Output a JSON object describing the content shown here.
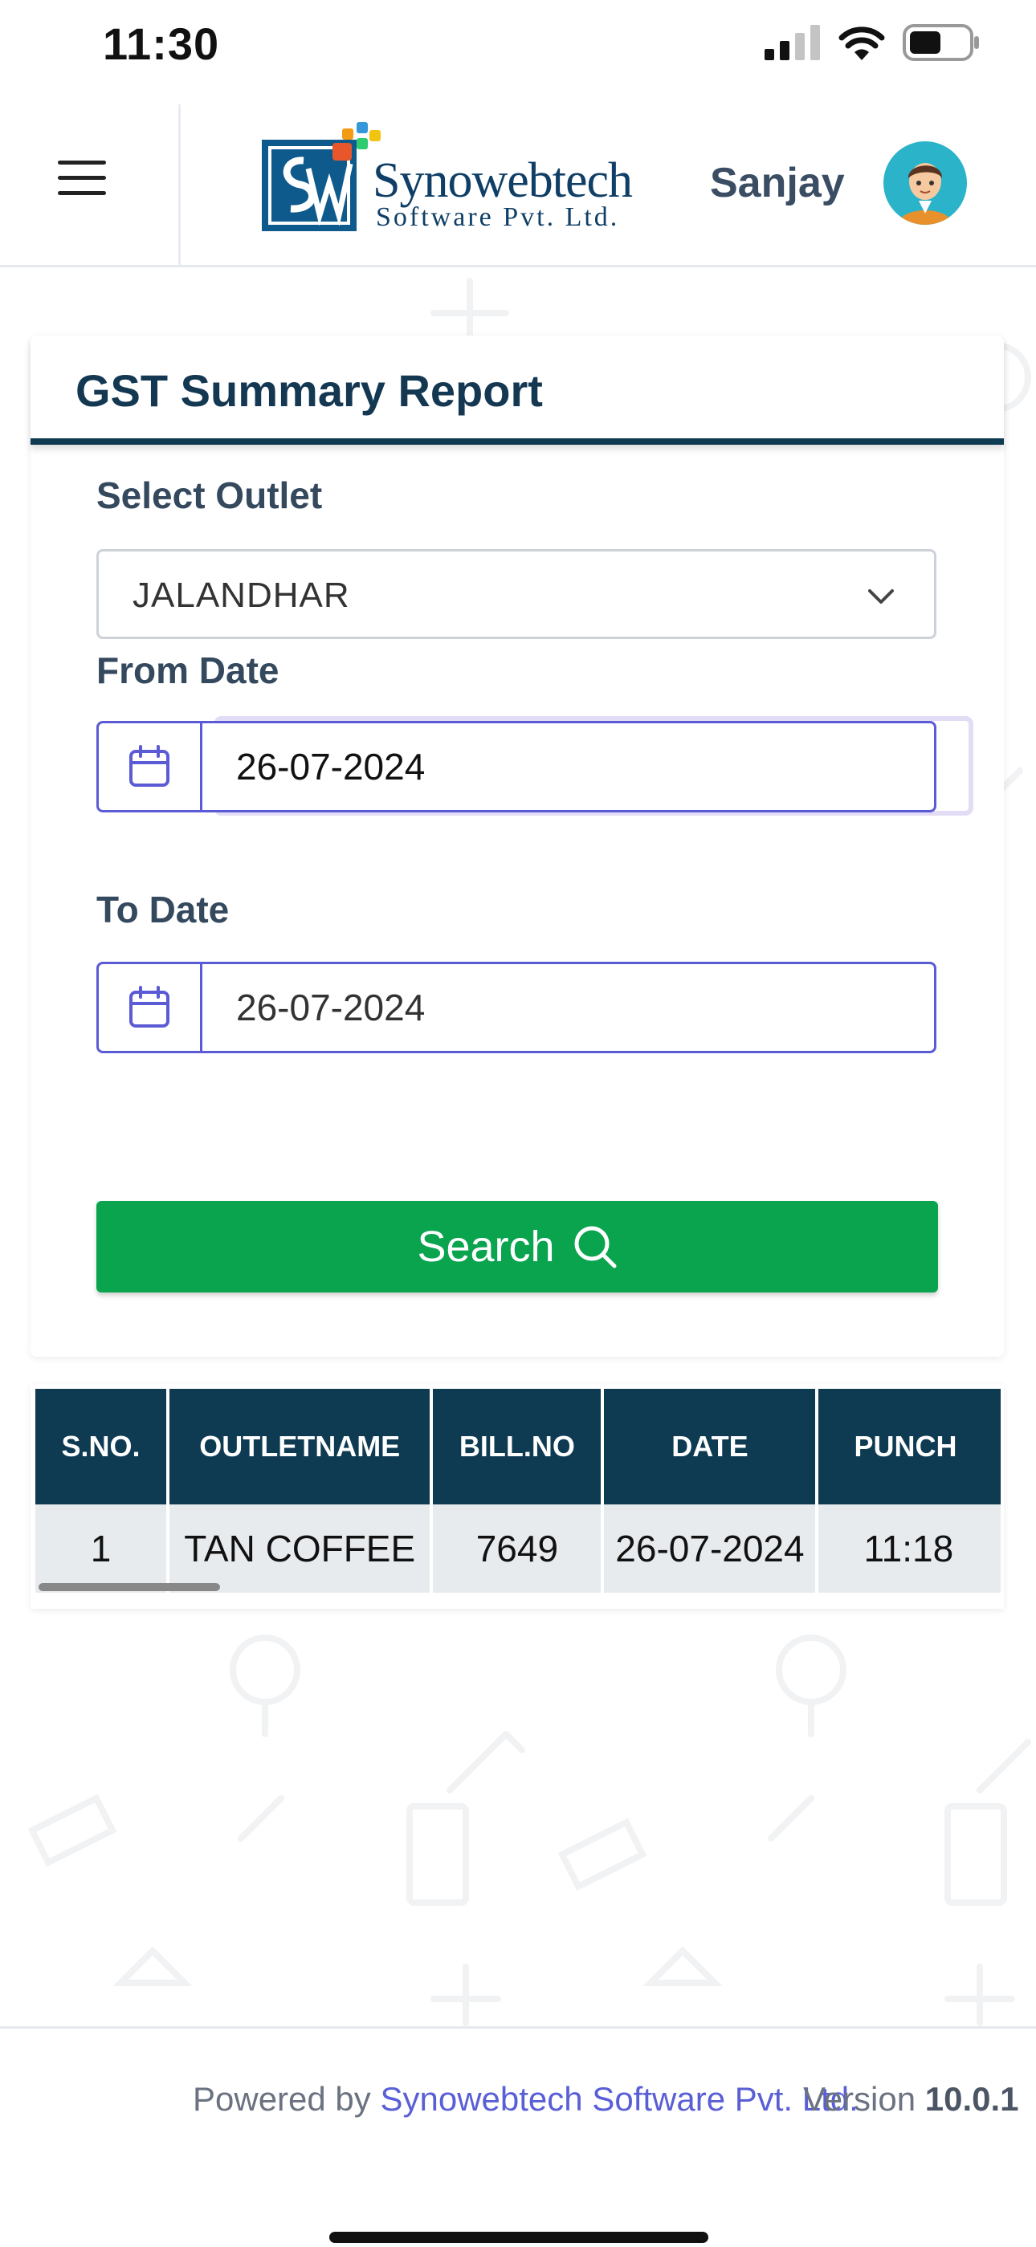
{
  "status_bar": {
    "time": "11:30"
  },
  "header": {
    "logo_name": "Synowebtech",
    "logo_sub": "Software Pvt. Ltd.",
    "username": "Sanjay"
  },
  "report": {
    "title": "GST Summary Report",
    "outlet_label": "Select Outlet",
    "outlet_value": "JALANDHAR",
    "from_label": "From Date",
    "from_value": "26-07-2024",
    "to_label": "To Date",
    "to_value": "26-07-2024",
    "search_label": "Search"
  },
  "table": {
    "columns": [
      "S.NO.",
      "OUTLETNAME",
      "BILL.NO",
      "DATE",
      "PUNCH"
    ],
    "rows": [
      [
        "1",
        "TAN COFFEE",
        "7649",
        "26-07-2024",
        "11:18"
      ]
    ]
  },
  "footer": {
    "powered_prefix": "Powered by ",
    "powered_company": "Synowebtech Software Pvt. Ltd.",
    "version_label": "Version ",
    "version_number": "10.0.1"
  },
  "colors": {
    "navy": "#0e3a52",
    "accent": "#5b5bd6",
    "search_green": "#0aa44f"
  },
  "icons": [
    "hamburger-icon",
    "chevron-down-icon",
    "calendar-icon",
    "search-icon",
    "signal-icon",
    "wifi-icon",
    "battery-icon"
  ]
}
